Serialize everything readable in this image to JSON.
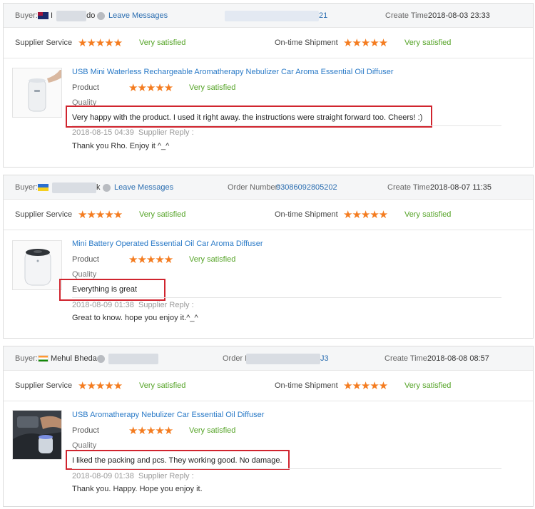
{
  "labels": {
    "buyer": "Buyer:",
    "leave_messages": "Leave Messages",
    "create_time": "Create Time:",
    "order_number": "Order Number:",
    "order_number_partial": "Order N",
    "supplier_service": "Supplier Service",
    "on_time_shipment": "On-time Shipment",
    "product": "Product",
    "quality": "Quality",
    "supplier_reply": "Supplier Reply :",
    "stars": "★★★★★",
    "very_satisfied": "Very satisfied"
  },
  "reviews": [
    {
      "buyer_name_fragment": "do",
      "buyer_initial": "I",
      "order_fragment": "21",
      "create_time": "2018-08-03 23:33",
      "product_title": "USB Mini Waterless Rechargeable Aromatherapy Nebulizer Car Aroma Essential Oil Diffuser",
      "review_text": "Very happy with the product. I used it right away. the instructions were straight forward too. Cheers! :)",
      "review_date": "2018-08-15 04:39",
      "reply_text": "Thank you Rho. Enjoy it ^_^"
    },
    {
      "buyer_name_fragment": "k",
      "order_number": "93086092805202",
      "create_time": "2018-08-07 11:35",
      "product_title": "Mini Battery Operated Essential Oil Car Aroma Diffuser",
      "review_text": "Everything is great",
      "review_date": "2018-08-09 01:38",
      "reply_text": "Great to know. hope you enjoy it.^_^"
    },
    {
      "buyer_name": "Mehul Bheda",
      "order_fragment": "J3",
      "create_time": "2018-08-08 08:57",
      "product_title": "USB Aromatherapy Nebulizer Car Essential Oil Diffuser",
      "review_text": "I liked the packing and pcs. They working good. No damage.",
      "review_date": "2018-08-09 01:38",
      "reply_text": "Thank you. Happy. Hope you enjoy it."
    }
  ],
  "colors": {
    "link": "#2a7ac7",
    "star": "#f47c20",
    "satisfied": "#56a428",
    "highlight_box": "#d0242e"
  }
}
